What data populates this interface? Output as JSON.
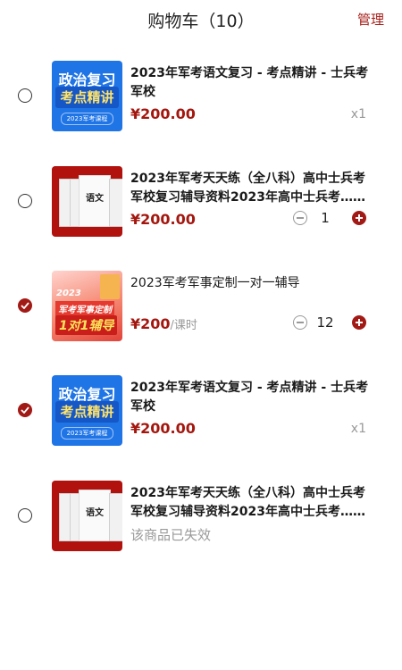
{
  "header": {
    "title": "购物车（10）",
    "manage": "管理"
  },
  "thumbs": {
    "blue": {
      "line1": "政治复习",
      "line2": "考点精讲",
      "line3": "2023军考课程"
    },
    "red": {
      "cover": "语文"
    },
    "pink": {
      "year": "2023",
      "mid": "军考军事定制",
      "big": "1对1辅导"
    }
  },
  "items": [
    {
      "name": "2023年军考语文复习 - 考点精讲 - 士兵考军校",
      "price": "¥200.00",
      "qty": "x1",
      "checked": false
    },
    {
      "name": "2023年军考天天练（全八科）高中士兵考军校复习辅导资料2023年高中士兵考……",
      "price": "¥200.00",
      "qty": "1",
      "checked": false
    },
    {
      "name": "2023军考军事定制一对一辅导",
      "price": "¥200",
      "price_unit": "/课时",
      "qty": "12",
      "checked": true
    },
    {
      "name": "2023年军考语文复习 - 考点精讲 - 士兵考军校",
      "price": "¥200.00",
      "qty": "x1",
      "checked": true
    },
    {
      "name": "2023年军考天天练（全八科）高中士兵考军校复习辅导资料2023年高中士兵考……",
      "status": "该商品已失效",
      "checked": false
    }
  ],
  "colors": {
    "accent": "#a21a15"
  }
}
